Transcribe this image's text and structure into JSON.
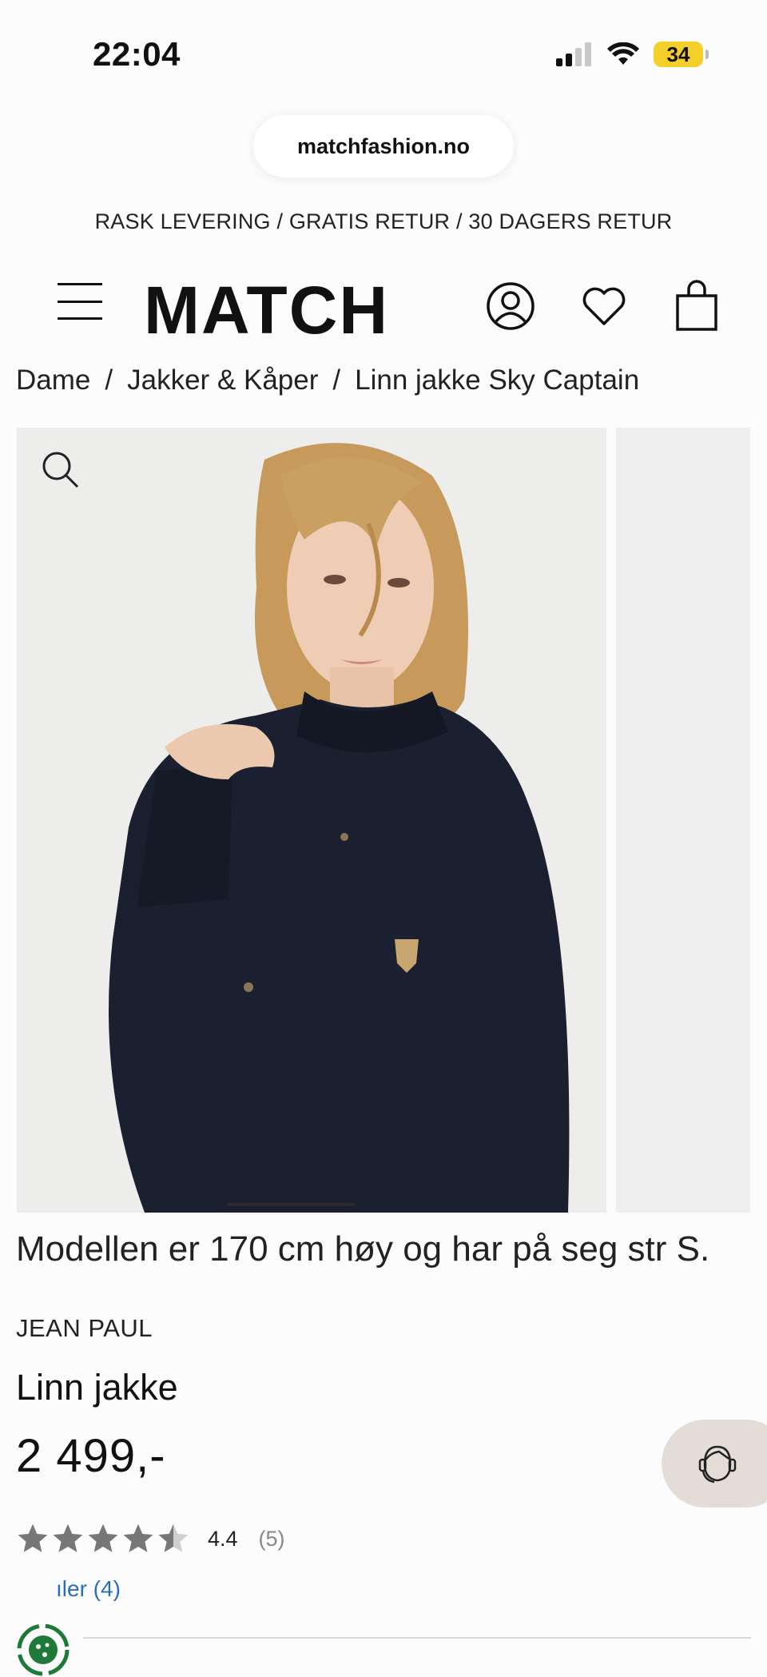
{
  "status_bar": {
    "time": "22:04",
    "battery": "34"
  },
  "browser": {
    "url": "matchfashion.no"
  },
  "promo": {
    "text": "RASK LEVERING / GRATIS RETUR / 30 DAGERS RETUR"
  },
  "header": {
    "logo": "MATCH"
  },
  "breadcrumb": {
    "items": [
      "Dame",
      "Jakker & Kåper",
      "Linn jakke Sky Captain"
    ],
    "separator": "/"
  },
  "product": {
    "model_note": "Modellen er 170 cm høy og har på seg str S.",
    "brand": "JEAN PAUL",
    "title": "Linn jakke",
    "price": "2 499,-",
    "rating_value": "4.4",
    "rating_count": "(5)",
    "rating": 4.4,
    "reviews_link": "ıler (4)"
  },
  "colors": {
    "accent_link": "#2a6fb5",
    "battery": "#f4cf2a",
    "chat_bg": "#e3dcd7",
    "jacket": "#1a1f2e"
  }
}
